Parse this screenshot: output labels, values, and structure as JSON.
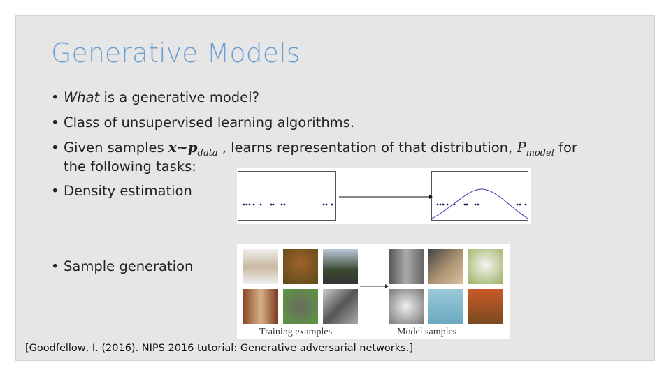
{
  "title": "Generative Models",
  "bullets": [
    {
      "em": "What",
      "rest": " is a generative model?"
    },
    {
      "text": "Class of unsupervised learning algorithms."
    },
    {
      "pre": "Given samples ",
      "math1": "x~p",
      "sub1": "data",
      "mid": " , learns representation of that distribution, ",
      "math2": "P",
      "sub2": "model",
      "post": " for",
      "line2": "the following tasks:"
    },
    {
      "text": "Density estimation"
    },
    {
      "text": "Sample generation"
    }
  ],
  "figure": {
    "training_label": "Training examples",
    "model_label": "Model samples",
    "training_images": [
      "coffee-cup",
      "mushroom",
      "street-traffic-light",
      "room-interior",
      "butterfly",
      "power-drill"
    ],
    "model_images": [
      "city-street",
      "cat",
      "teapot-flowers",
      "dog",
      "swimmer",
      "mosque-sunset"
    ]
  },
  "citation": "[Goodfellow, I. (2016). NIPS 2016 tutorial: Generative adversarial networks.]",
  "colors": {
    "title": "#6b9fd3",
    "curve": "#3a3ab0",
    "points": "#1a1a5a"
  }
}
